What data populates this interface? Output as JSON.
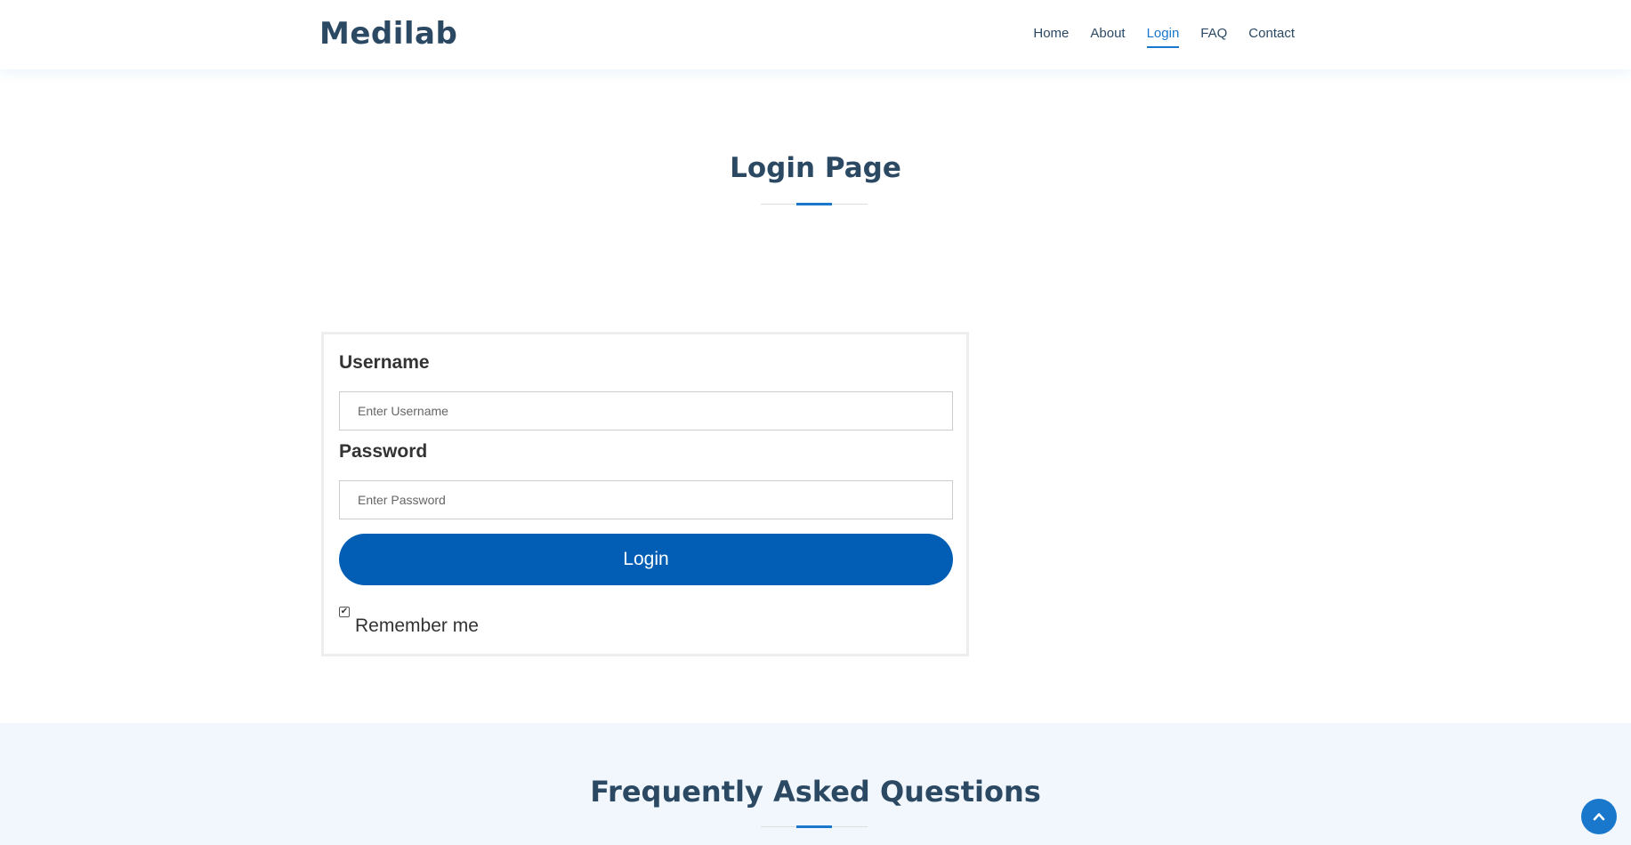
{
  "header": {
    "logo": "Medilab",
    "nav": [
      {
        "label": "Home",
        "active": false
      },
      {
        "label": "About",
        "active": false
      },
      {
        "label": "Login",
        "active": true
      },
      {
        "label": "FAQ",
        "active": false
      },
      {
        "label": "Contact",
        "active": false
      }
    ]
  },
  "login_section": {
    "title": "Login Page",
    "form": {
      "username_label": "Username",
      "username_placeholder": "Enter Username",
      "password_label": "Password",
      "password_placeholder": "Enter Password",
      "submit_label": "Login",
      "remember_label": "Remember me",
      "remember_checked": true
    }
  },
  "faq_section": {
    "title": "Frequently Asked Questions"
  },
  "icons": {
    "scroll_top": "chevron-up-icon",
    "remember_check": "checkmark-icon"
  },
  "colors": {
    "brand": "#2c4964",
    "accent": "#1977cc",
    "button": "#015eb4",
    "faq_background": "#f1f7fd"
  }
}
